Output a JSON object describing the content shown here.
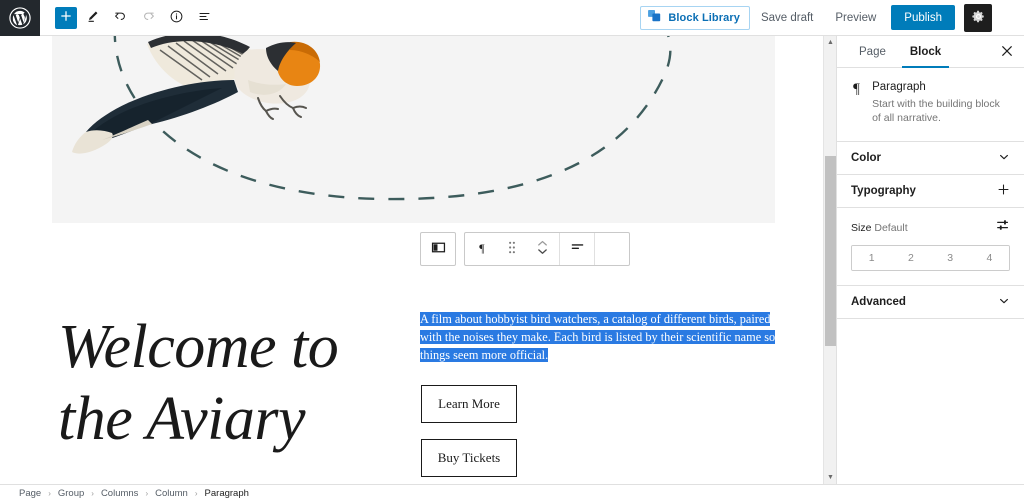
{
  "topbar": {
    "logo_icon": "wordpress-logo-icon",
    "tools": [
      {
        "name": "add-block-button",
        "icon": "plus-icon",
        "label": "+"
      },
      {
        "name": "edit-tool-button",
        "icon": "pencil-icon",
        "label": ""
      },
      {
        "name": "undo-button",
        "icon": "undo-arrow-icon",
        "label": ""
      },
      {
        "name": "redo-button",
        "icon": "redo-arrow-icon",
        "label": ""
      },
      {
        "name": "details-button",
        "icon": "info-circle-icon",
        "label": ""
      },
      {
        "name": "list-view-button",
        "icon": "list-view-icon",
        "label": ""
      }
    ],
    "block_library_label": "Block Library",
    "block_library_icon": "blocks-icon",
    "save_draft_label": "Save draft",
    "preview_label": "Preview",
    "publish_label": "Publish",
    "settings_icon": "gear-icon",
    "options_icon": "kebab-menu-icon"
  },
  "canvas": {
    "heading": "Welcome to the Aviary",
    "paragraph": "A film about hobbyist bird watchers, a catalog of different birds, paired with the noises they make. Each bird is listed by their scientific name so things seem more official.",
    "buttons": [
      {
        "name": "learn-more-button",
        "label": "Learn More"
      },
      {
        "name": "buy-tickets-button",
        "label": "Buy Tickets"
      }
    ],
    "image_alt": "bird-illustration",
    "decoration": "dashed-flight-path-curve",
    "block_toolbar": [
      {
        "name": "change-block-type-button",
        "icon": "columns-block-icon"
      },
      {
        "name": "paragraph-block-icon",
        "icon": "paragraph-pilcrow-icon"
      },
      {
        "name": "drag-handle",
        "icon": "drag-dots-icon"
      },
      {
        "name": "move-up-down-button",
        "icon": "chevron-up-down-icon"
      },
      {
        "name": "align-text-button",
        "icon": "align-left-icon"
      },
      {
        "name": "block-options-button",
        "icon": "kebab-menu-icon"
      }
    ],
    "scrollbar": {
      "name": "editor-vertical-scrollbar"
    }
  },
  "sidebar": {
    "tabs": [
      {
        "name": "tab-page",
        "label": "Page",
        "active": false
      },
      {
        "name": "tab-block",
        "label": "Block",
        "active": true
      }
    ],
    "close_icon": "close-icon",
    "block_card": {
      "icon": "paragraph-pilcrow-icon",
      "title": "Paragraph",
      "description": "Start with the building block of all narrative."
    },
    "panels": [
      {
        "name": "color-panel",
        "label": "Color",
        "control": "chevron-down-icon"
      },
      {
        "name": "typography-panel",
        "label": "Typography",
        "control": "plus-icon"
      }
    ],
    "typography": {
      "size_label": "Size",
      "size_value": "Default",
      "reset_icon": "sliders-icon",
      "size_options": [
        "1",
        "2",
        "3",
        "4"
      ]
    },
    "advanced": {
      "name": "advanced-panel",
      "label": "Advanced",
      "control": "chevron-down-icon"
    }
  },
  "breadcrumb": {
    "items": [
      "Page",
      "Group",
      "Columns",
      "Column",
      "Paragraph"
    ],
    "separator": "›"
  },
  "colors": {
    "accent_blue": "#007cba",
    "selection_blue": "#2a7ae2",
    "dark": "#1e1e1e",
    "canvas_gray": "#f4f4f4",
    "dash_teal": "#3d5c5c"
  }
}
